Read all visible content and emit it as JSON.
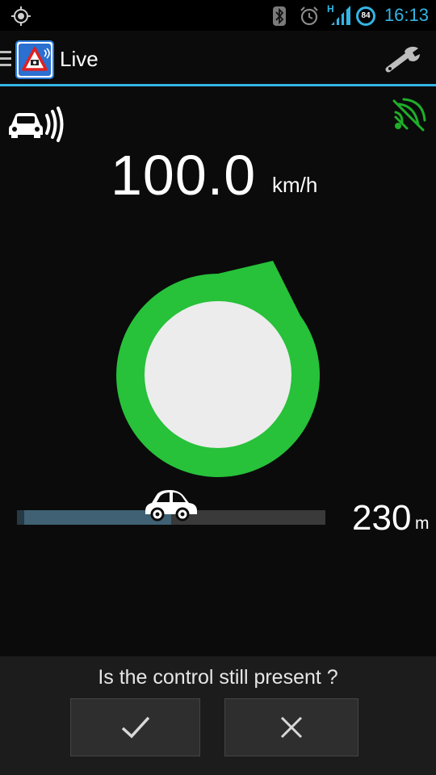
{
  "status_bar": {
    "time": "16:13",
    "network_type": "H",
    "battery_level": "84",
    "icons": [
      "gps-icon",
      "bluetooth-icon",
      "alarm-icon",
      "signal-icon",
      "battery-icon"
    ]
  },
  "action_bar": {
    "title": "Live",
    "icons": [
      "menu-icon",
      "app-logo-icon",
      "settings-wrench-icon"
    ]
  },
  "speed": {
    "value": "100.0",
    "unit": "km/h"
  },
  "distance": {
    "value": "230",
    "unit": "m",
    "progress_fraction": 0.5
  },
  "indicator": {
    "ring_color": "#27c13a",
    "center_color": "#ececec",
    "gps_status_color": "#1fae29"
  },
  "accent_color": "#33b5e5",
  "prompt": {
    "question": "Is the control still present ?",
    "confirm_icon": "check-icon",
    "reject_icon": "close-icon"
  }
}
